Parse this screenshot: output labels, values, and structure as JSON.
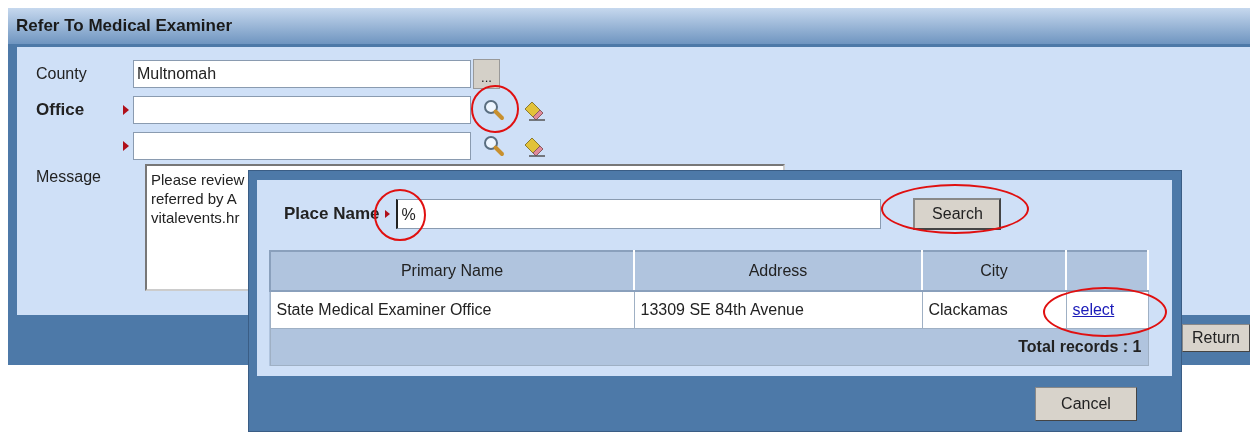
{
  "window": {
    "title": "Refer To Medical Examiner"
  },
  "form": {
    "fields": [
      {
        "label": "County",
        "value": "Multnomah",
        "kind": "lookup",
        "button": "...",
        "required": false,
        "circled": false
      },
      {
        "label": "Office",
        "kind": "search",
        "required": true,
        "circled": true
      },
      {
        "kind": "search",
        "required": true,
        "circled": false
      }
    ],
    "message": {
      "label": "Message",
      "lines": [
        "Please review",
        "referred by A",
        "vitalevents.hr"
      ]
    }
  },
  "buttons": [
    {
      "label": "Return"
    }
  ],
  "dialog": {
    "place_name": {
      "label": "Place Name",
      "value": "%",
      "circled": true
    },
    "search_button": {
      "label": "Search",
      "circled": true
    },
    "table": {
      "columns": [
        "Primary Name",
        "Address",
        "City"
      ],
      "rows": [
        {
          "cells": [
            "State Medical Examiner Office",
            "13309 SE 84th Avenue",
            "Clackamas"
          ],
          "action": "select",
          "action_circled": true
        }
      ],
      "footer": "Total records : 1"
    },
    "cancel_button": {
      "label": "Cancel"
    }
  }
}
